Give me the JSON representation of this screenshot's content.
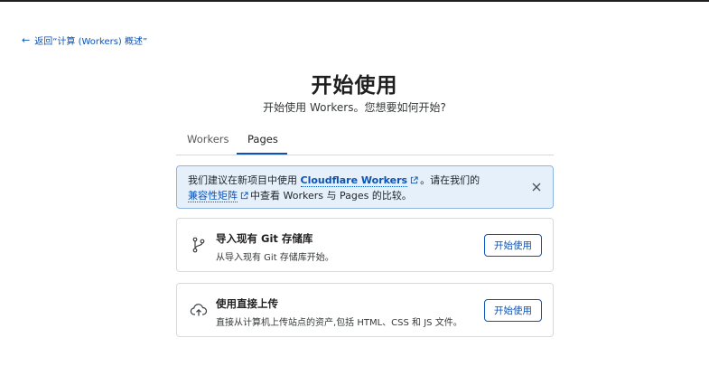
{
  "back_link": {
    "label": "返回“计算 (Workers) 概述”"
  },
  "header": {
    "title": "开始使用",
    "subtitle": "开始使用 Workers。您想要如何开始?"
  },
  "tabs": [
    {
      "label": "Workers",
      "active": false
    },
    {
      "label": "Pages",
      "active": true
    }
  ],
  "info_banner": {
    "text_1": "我们建议在新项目中使用",
    "link_1": "Cloudflare Workers",
    "text_2": "。请在我们的",
    "link_2": "兼容性矩阵",
    "text_3": "中查看 Workers 与 Pages 的比较。"
  },
  "cards": [
    {
      "title": "导入现有 Git 存储库",
      "description": "从导入现有 Git 存储库开始。",
      "button": "开始使用",
      "icon": "git-branch-icon"
    },
    {
      "title": "使用直接上传",
      "description": "直接从计算机上传站点的资产,包括 HTML、CSS 和 JS 文件。",
      "button": "开始使用",
      "icon": "cloud-upload-icon"
    }
  ],
  "colors": {
    "accent": "#0b53b8",
    "banner_bg": "#e5f0fb",
    "banner_border": "#8db5e3"
  }
}
